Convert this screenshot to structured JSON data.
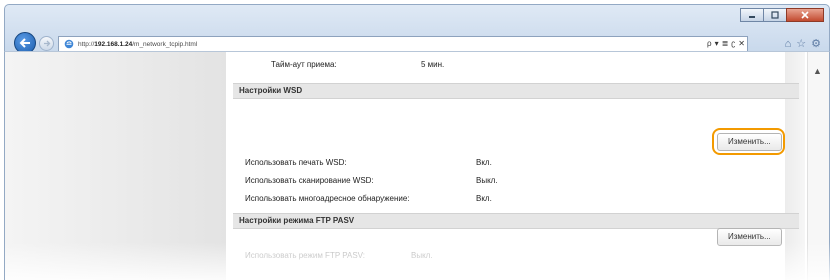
{
  "browser": {
    "url_prefix": "http://",
    "url_host": "192.168.1.24",
    "url_path": "/m_network_tcpip.html",
    "search_tool": "ρ",
    "tools_glyphs": [
      "▾",
      "≣",
      "ʗ",
      "✕"
    ],
    "minimize_icon": "minimize-icon",
    "maximize_icon": "maximize-icon",
    "close_icon": "close-icon"
  },
  "page": {
    "receive_timeout_label": "Тайм-аут приема:",
    "receive_timeout_value": "5 мин.",
    "wsd_section": {
      "title": "Настройки WSD",
      "edit_label": "Изменить...",
      "rows": [
        {
          "label": "Использовать печать WSD:",
          "value": "Вкл."
        },
        {
          "label": "Использовать сканирование WSD:",
          "value": "Выкл."
        },
        {
          "label": "Использовать многоадресное обнаружение:",
          "value": "Вкл."
        }
      ]
    },
    "ftp_section": {
      "title": "Настройки режима FTP PASV",
      "edit_label": "Изменить...",
      "rows": [
        {
          "label": "Использовать режим FTP PASV:",
          "value": "Выкл."
        }
      ]
    }
  },
  "colors": {
    "highlight_ring": "#f39a00",
    "back_button": "#1b5dad",
    "section_header_bg": "#e6e6e6"
  }
}
